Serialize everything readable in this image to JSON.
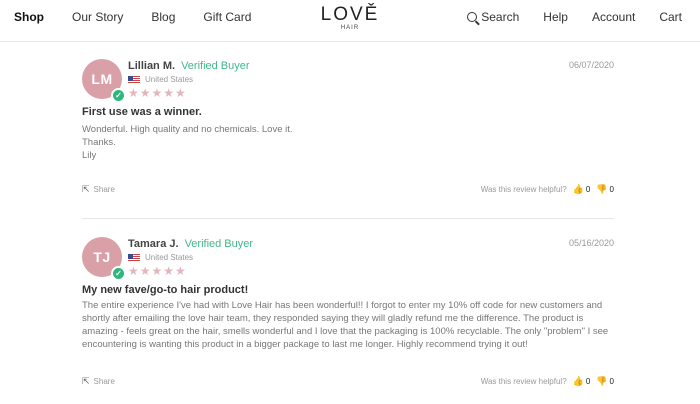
{
  "nav": {
    "left": [
      "Shop",
      "Our Story",
      "Blog",
      "Gift Card"
    ],
    "right": [
      "Search",
      "Help",
      "Account",
      "Cart"
    ]
  },
  "logo": {
    "main": "LOVĚ",
    "sub": "HAIR"
  },
  "reviews": [
    {
      "initials": "LM",
      "name": "Lillian M.",
      "verified": "Verified Buyer",
      "country": "United States",
      "stars": "★★★★★",
      "date": "06/07/2020",
      "title": "First use was a winner.",
      "body_lines": [
        "Wonderful. High quality and no chemicals. Love it.",
        "Thanks.",
        "Lily"
      ],
      "share": "Share",
      "helpful_label": "Was this review helpful?",
      "up": "0",
      "down": "0"
    },
    {
      "initials": "TJ",
      "name": "Tamara J.",
      "verified": "Verified Buyer",
      "country": "United States",
      "stars": "★★★★★",
      "date": "05/16/2020",
      "title": "My new fave/go-to hair product!",
      "body": "The entire experience I've had with Love Hair has been wonderful!! I forgot to enter my 10% off code for new customers and shortly after emailing the love hair team, they responded saying they will gladly refund me the difference. The product is amazing - feels great on the hair, smells wonderful and I love that the packaging is 100% recyclable. The only \"problem\" I see encountering is wanting this product in a bigger package to last me longer. Highly recommend trying it out!",
      "share": "Share",
      "helpful_label": "Was this review helpful?",
      "up": "0",
      "down": "0"
    }
  ],
  "colors": {
    "avatar": "#d9a0a8",
    "verified": "#3fb88a",
    "stars": "#e3b6bd"
  }
}
